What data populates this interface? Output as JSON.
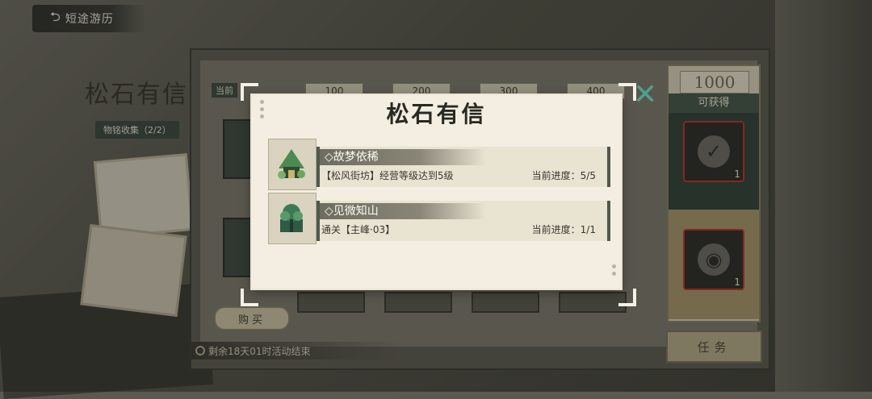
{
  "header": {
    "back_icon": "back-arrow-icon",
    "title": "短途游历"
  },
  "left_panel": {
    "event_title": "松石有信",
    "collection_badge": "物铭收集（2/2）"
  },
  "milestones": {
    "current_tag": "当前",
    "values": [
      "100",
      "200",
      "300",
      "400"
    ]
  },
  "buy_button": {
    "label": "购买"
  },
  "footer": {
    "time_left": "剩余18天01时活动结束"
  },
  "rewards": {
    "points": "1000",
    "label": "可获得",
    "items": [
      {
        "icon": "check-badge-icon",
        "count": "1"
      },
      {
        "icon": "bag-icon",
        "count": "1"
      }
    ]
  },
  "task_button": {
    "label": "任务"
  },
  "modal": {
    "title": "松石有信",
    "close_icon": "close-icon",
    "items": [
      {
        "name": "◇故梦依稀",
        "requirement": "【松风街坊】经营等级达到5级",
        "progress": "当前进度：5/5"
      },
      {
        "name": "◇见微知山",
        "requirement": "通关【主峰·03】",
        "progress": "当前进度：1/1"
      }
    ]
  },
  "colors": {
    "accent_green": "#4fa08a",
    "dark_green": "#314338",
    "paper": "#f3eee1",
    "reward_border": "#c4342f"
  }
}
